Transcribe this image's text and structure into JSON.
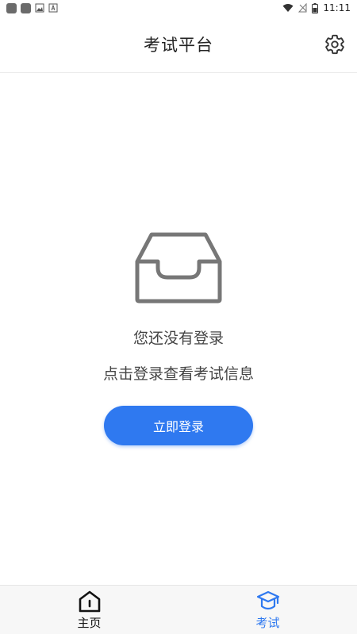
{
  "status_bar": {
    "time": "11:11"
  },
  "app_bar": {
    "title": "考试平台",
    "settings_icon": "gear-icon"
  },
  "empty_state": {
    "icon": "inbox-icon",
    "message_line1": "您还没有登录",
    "message_line2": "点击登录查看考试信息",
    "login_button": "立即登录"
  },
  "bottom_nav": {
    "items": [
      {
        "label": "主页",
        "icon": "home-icon",
        "active": false
      },
      {
        "label": "考试",
        "icon": "graduation-cap-icon",
        "active": true
      }
    ]
  },
  "colors": {
    "accent": "#2f79f0",
    "icon_gray": "#777777"
  }
}
